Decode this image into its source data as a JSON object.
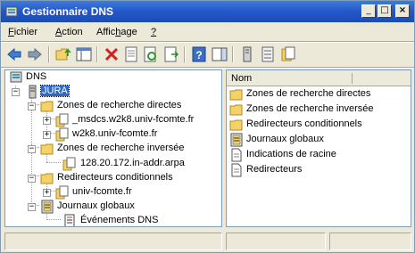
{
  "window": {
    "title": "Gestionnaire DNS",
    "controls": {
      "minimize": "_",
      "maximize": "□",
      "close": "×"
    }
  },
  "menu": [
    {
      "label_pre": "",
      "label_u": "F",
      "label_post": "ichier"
    },
    {
      "label_pre": "",
      "label_u": "A",
      "label_post": "ction"
    },
    {
      "label_pre": "Affic",
      "label_u": "h",
      "label_post": "age"
    },
    {
      "label_pre": "",
      "label_u": "?",
      "label_post": ""
    }
  ],
  "toolbar": [
    "back-arrow-icon",
    "forward-arrow-icon",
    "up-folder-icon",
    "show-hide-tree-icon",
    "delete-icon",
    "properties-icon",
    "refresh-icon",
    "export-list-icon",
    "help-icon",
    "action-pane-icon",
    "server-icon",
    "list-icon",
    "zone-icon"
  ],
  "tree": {
    "root": "DNS",
    "server": "JURA",
    "forward_zones": "Zones de recherche directes",
    "forward_items": [
      "_msdcs.w2k8.univ-fcomte.fr",
      "w2k8.univ-fcomte.fr"
    ],
    "reverse_zones": "Zones de recherche inversée",
    "reverse_items": [
      "128.20.172.in-addr.arpa"
    ],
    "forwarders": "Redirecteurs conditionnels",
    "forwarder_items": [
      "univ-fcomte.fr"
    ],
    "logs": "Journaux globaux",
    "log_items": [
      "Événements DNS"
    ]
  },
  "list": {
    "column_name": "Nom",
    "items": [
      {
        "label": "Zones de recherche directes",
        "icon": "folder-icon"
      },
      {
        "label": "Zones de recherche inversée",
        "icon": "folder-icon"
      },
      {
        "label": "Redirecteurs conditionnels",
        "icon": "folder-icon"
      },
      {
        "label": "Journaux globaux",
        "icon": "log-icon"
      },
      {
        "label": "Indications de racine",
        "icon": "document-icon"
      },
      {
        "label": "Redirecteurs",
        "icon": "document-icon"
      }
    ]
  },
  "colors": {
    "titlebar": "#2456c9",
    "selection": "#316ac5",
    "folder": "#f4d26a"
  }
}
